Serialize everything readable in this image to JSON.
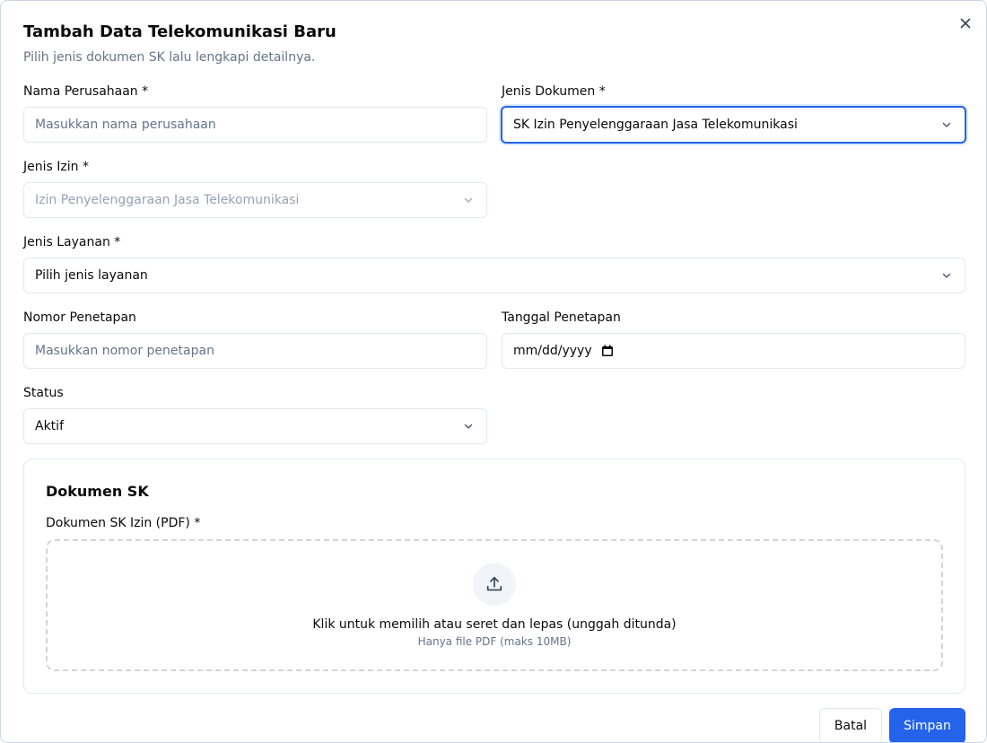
{
  "dialog": {
    "title": "Tambah Data Telekomunikasi Baru",
    "subtitle": "Pilih jenis dokumen SK lalu lengkapi detailnya."
  },
  "form": {
    "nama_perusahaan": {
      "label": "Nama Perusahaan *",
      "placeholder": "Masukkan nama perusahaan",
      "value": ""
    },
    "jenis_dokumen": {
      "label": "Jenis Dokumen *",
      "selected": "SK Izin Penyelenggaraan Jasa Telekomunikasi"
    },
    "jenis_izin": {
      "label": "Jenis Izin *",
      "selected": "Izin Penyelenggaraan Jasa Telekomunikasi",
      "disabled": true
    },
    "jenis_layanan": {
      "label": "Jenis Layanan *",
      "selected": "Pilih jenis layanan"
    },
    "nomor_penetapan": {
      "label": "Nomor Penetapan",
      "placeholder": "Masukkan nomor penetapan",
      "value": ""
    },
    "tanggal_penetapan": {
      "label": "Tanggal Penetapan",
      "placeholder": "mm/dd/yyyy"
    },
    "status": {
      "label": "Status",
      "selected": "Aktif"
    }
  },
  "dokumen": {
    "title": "Dokumen SK",
    "field_label": "Dokumen SK Izin (PDF) *",
    "drop_text": "Klik untuk memilih atau seret dan lepas (unggah ditunda)",
    "drop_hint": "Hanya file PDF (maks 10MB)"
  },
  "actions": {
    "cancel": "Batal",
    "save": "Simpan"
  },
  "icons": {
    "close": "close-icon",
    "chevron": "chevron-down-icon",
    "calendar": "calendar-icon",
    "upload": "upload-icon"
  },
  "colors": {
    "primary": "#2563eb",
    "muted_text": "#64748b",
    "border": "#e2e8f0"
  }
}
